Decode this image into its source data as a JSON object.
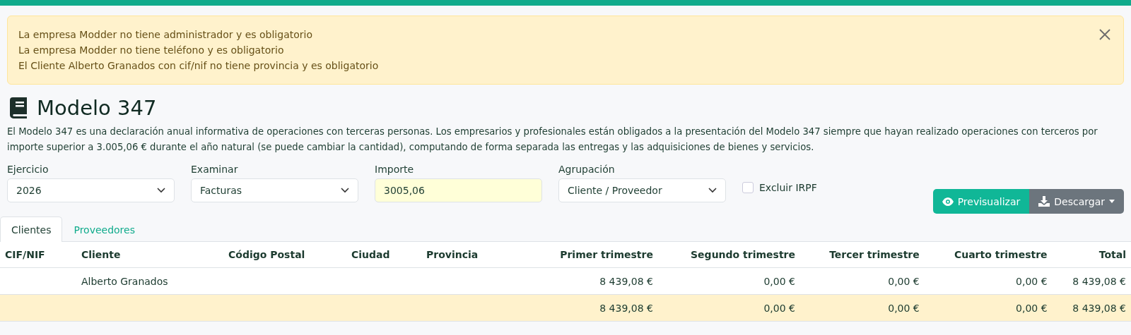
{
  "alert": {
    "messages": [
      "La empresa Modder no tiene administrador y es obligatorio",
      "La empresa Modder no tiene teléfono y es obligatorio",
      "El Cliente Alberto Granados con cif/nif no tiene provincia y es obligatorio"
    ]
  },
  "title": "Modelo 347",
  "description": "El Modelo 347 es una declaración anual informativa de operaciones con terceras personas. Los empresarios y profesionales están obligados a la presentación del Modelo 347 siempre que hayan realizado operaciones con terceros por importe superior a 3.005,06 € durante el año natural (se puede cambiar la cantidad), computando de forma separada las entregas y las adquisiciones de bienes y servicios.",
  "filters": [
    {
      "kind": "select",
      "label": "Ejercicio",
      "value": "2026"
    },
    {
      "kind": "select",
      "label": "Examinar",
      "value": "Facturas"
    },
    {
      "kind": "input",
      "label": "Importe",
      "value": "3005,06"
    },
    {
      "kind": "select",
      "label": "Agrupación",
      "value": "Cliente / Proveedor"
    }
  ],
  "exclude_irpf": {
    "label": "Excluir IRPF",
    "checked": false
  },
  "buttons": [
    {
      "kind": "preview",
      "label": "Previsualizar"
    },
    {
      "kind": "download",
      "label": "Descargar"
    }
  ],
  "tabs": [
    {
      "label": "Clientes",
      "selected": true
    },
    {
      "label": "Proveedores",
      "selected": false
    }
  ],
  "table": {
    "columns": [
      {
        "label": "CIF/NIF",
        "kind": "text"
      },
      {
        "label": "Cliente",
        "kind": "text"
      },
      {
        "label": "Código Postal",
        "kind": "text"
      },
      {
        "label": "Ciudad",
        "kind": "text"
      },
      {
        "label": "Provincia",
        "kind": "text"
      },
      {
        "label": "Primer trimestre",
        "kind": "amount"
      },
      {
        "label": "Segundo trimestre",
        "kind": "amount"
      },
      {
        "label": "Tercer trimestre",
        "kind": "amount"
      },
      {
        "label": "Cuarto trimestre",
        "kind": "amount"
      },
      {
        "label": "Total",
        "kind": "amount"
      }
    ],
    "rows": [
      {
        "kind": "data",
        "cells": [
          "",
          "Alberto Granados",
          "",
          "",
          "",
          "8 439,08 €",
          "0,00 €",
          "0,00 €",
          "0,00 €",
          "8 439,08 €"
        ]
      },
      {
        "kind": "total",
        "cells": [
          "",
          "",
          "",
          "",
          "",
          "8 439,08 €",
          "0,00 €",
          "0,00 €",
          "0,00 €",
          "8 439,08 €"
        ]
      }
    ]
  }
}
